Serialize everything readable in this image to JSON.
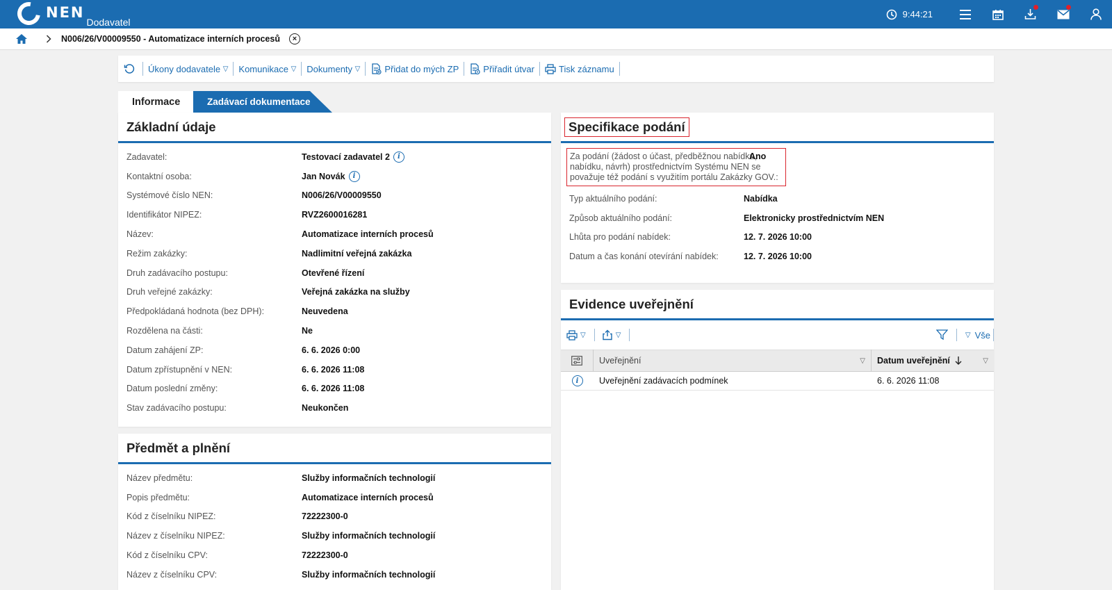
{
  "app": {
    "logo_text": "NEN",
    "role": "Dodavatel",
    "time": "9:44:21"
  },
  "breadcrumb": {
    "title": "N006/26/V00009550 - Automatizace interních procesů"
  },
  "toolbar": {
    "ukony": "Úkony dodavatele",
    "komunikace": "Komunikace",
    "dokumenty": "Dokumenty",
    "pridat": "Přidat do mých ZP",
    "priradit": "Přiřadit útvar",
    "tisk": "Tisk záznamu"
  },
  "tabs": {
    "info": "Informace",
    "doc": "Zadávací dokumentace"
  },
  "basic": {
    "title": "Základní údaje",
    "rows": [
      {
        "label": "Zadavatel:",
        "value": "Testovací zadavatel 2"
      },
      {
        "label": "Kontaktní osoba:",
        "value": "Jan Novák"
      },
      {
        "label": "Systémové číslo NEN:",
        "value": "N006/26/V00009550"
      },
      {
        "label": "Identifikátor NIPEZ:",
        "value": "RVZ2600016281"
      },
      {
        "label": "Název:",
        "value": "Automatizace interních procesů"
      },
      {
        "label": "Režim zakázky:",
        "value": "Nadlimitní veřejná zakázka"
      },
      {
        "label": "Druh zadávacího postupu:",
        "value": "Otevřené řízení"
      },
      {
        "label": "Druh veřejné zakázky:",
        "value": "Veřejná zakázka na služby"
      },
      {
        "label": "Předpokládaná hodnota (bez DPH):",
        "value": "Neuvedena"
      },
      {
        "label": "Rozdělena na části:",
        "value": "Ne"
      },
      {
        "label": "Datum zahájení ZP:",
        "value": "6. 6. 2026 0:00"
      },
      {
        "label": "Datum zpřístupnění v NEN:",
        "value": "6. 6. 2026 11:08"
      },
      {
        "label": "Datum poslední změny:",
        "value": "6. 6. 2026 11:08"
      },
      {
        "label": "Stav zadávacího postupu:",
        "value": "Neukončen"
      }
    ]
  },
  "subject": {
    "title": "Předmět a plnění",
    "rows": [
      {
        "label": "Název předmětu:",
        "value": "Služby informačních technologií"
      },
      {
        "label": "Popis předmětu:",
        "value": "Automatizace interních procesů"
      },
      {
        "label": "Kód z číselníku NIPEZ:",
        "value": "72222300-0"
      },
      {
        "label": "Název z číselníku NIPEZ:",
        "value": "Služby informačních technologií"
      },
      {
        "label": "Kód z číselníku CPV:",
        "value": "72222300-0"
      },
      {
        "label": "Název z číselníku CPV:",
        "value": "Služby informačních technologií"
      }
    ]
  },
  "spec": {
    "title": "Specifikace podání",
    "highlight_label": "Za podání (žádost o účast, předběžnou nabídku, nabídku, návrh) prostřednictvím Systému NEN se považuje též podání s využitím portálu Zakázky GOV.:",
    "highlight_value": "Ano",
    "rows": [
      {
        "label": "Typ aktuálního podání:",
        "value": "Nabídka"
      },
      {
        "label": "Způsob aktuálního podání:",
        "value": "Elektronicky prostřednictvím NEN"
      },
      {
        "label": "Lhůta pro podání nabídek:",
        "value": "12. 7. 2026 10:00"
      },
      {
        "label": "Datum a čas konání otevírání nabídek:",
        "value": "12. 7. 2026 10:00"
      }
    ]
  },
  "evidence": {
    "title": "Evidence uveřejnění",
    "filter_all": "Vše",
    "col_pub": "Uveřejnění",
    "col_date": "Datum uveřejnění",
    "rows": [
      {
        "pub": "Uveřejnění zadávacích podmínek",
        "date": "6. 6. 2026 11:08"
      }
    ]
  }
}
